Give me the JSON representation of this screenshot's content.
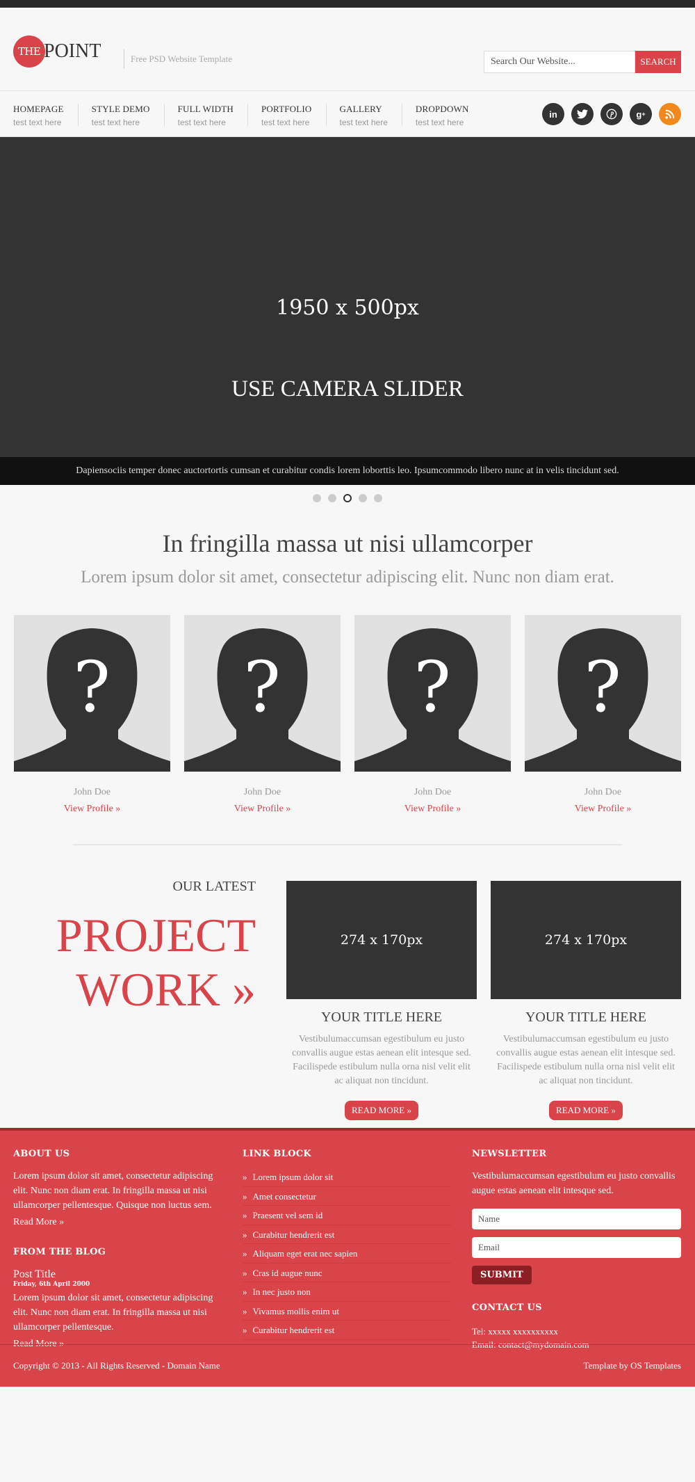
{
  "header": {
    "logo_the": "THE",
    "logo_point": "POINT",
    "tagline": "Free PSD Website Template",
    "search_placeholder": "Search Our Website...",
    "search_button": "SEARCH"
  },
  "nav": {
    "items": [
      {
        "label": "HOMEPAGE",
        "sub": "test text here"
      },
      {
        "label": "STYLE DEMO",
        "sub": "test text here"
      },
      {
        "label": "FULL WIDTH",
        "sub": "test text here"
      },
      {
        "label": "PORTFOLIO",
        "sub": "test text here"
      },
      {
        "label": "GALLERY",
        "sub": "test text here"
      },
      {
        "label": "DROPDOWN",
        "sub": "test text here"
      }
    ],
    "social_icons": [
      "linkedin-icon",
      "twitter-icon",
      "pinterest-icon",
      "google-plus-icon",
      "rss-icon"
    ]
  },
  "hero": {
    "size_label": "1950 x 500px",
    "title": "USE CAMERA SLIDER",
    "caption": "Dapiensociis temper donec auctortortis cumsan et curabitur condis lorem loborttis leo. Ipsumcommodo libero nunc at in velis tincidunt sed.",
    "slides": 5,
    "active_slide": 3
  },
  "intro": {
    "heading": "In fringilla massa ut nisi ullamcorper",
    "subheading": "Lorem ipsum dolor sit amet, consectetur adipiscing elit. Nunc non diam erat."
  },
  "team": [
    {
      "name": "John Doe",
      "link": "View Profile »"
    },
    {
      "name": "John Doe",
      "link": "View Profile »"
    },
    {
      "name": "John Doe",
      "link": "View Profile »"
    },
    {
      "name": "John Doe",
      "link": "View Profile »"
    }
  ],
  "projects": {
    "kicker": "OUR LATEST",
    "title_line1": "PROJECT",
    "title_line2": "WORK »",
    "cards": [
      {
        "image_label": "274 x 170px",
        "title": "YOUR TITLE HERE",
        "text": "Vestibulumaccumsan egestibulum eu justo convallis augue estas aenean elit intesque sed. Facilispede estibulum nulla orna nisl velit elit ac aliquat non tincidunt.",
        "button": "READ MORE »"
      },
      {
        "image_label": "274 x 170px",
        "title": "YOUR TITLE HERE",
        "text": "Vestibulumaccumsan egestibulum eu justo convallis augue estas aenean elit intesque sed. Facilispede estibulum nulla orna nisl velit elit ac aliquat non tincidunt.",
        "button": "READ MORE »"
      }
    ]
  },
  "footer": {
    "about_heading": "ABOUT US",
    "about_text": "Lorem ipsum dolor sit amet, consectetur adipiscing elit. Nunc non diam erat. In fringilla massa ut nisi ullamcorper pellentesque. Quisque non luctus sem.",
    "about_read_more": "Read More »",
    "blog_heading": "FROM THE BLOG",
    "post_title": "Post Title",
    "post_date": "Friday, 6th April 2000",
    "post_text": "Lorem ipsum dolor sit amet, consectetur adipiscing elit. Nunc non diam erat. In fringilla massa ut nisi ullamcorper pellentesque.",
    "post_read_more": "Read More »",
    "links_heading": "LINK BLOCK",
    "links": [
      "Lorem ipsum dolor sit",
      "Amet consectetur",
      "Praesent vel sem id",
      "Curabitur hendrerit est",
      "Aliquam eget erat nec sapien",
      "Cras id augue nunc",
      "In nec justo non",
      "Vivamus mollis enim ut",
      "Curabitur hendrerit est"
    ],
    "newsletter_heading": "NEWSLETTER",
    "newsletter_text": "Vestibulumaccumsan egestibulum eu justo convallis augue estas aenean elit intesque sed.",
    "name_placeholder": "Name",
    "email_placeholder": "Email",
    "submit": "SUBMIT",
    "contact_heading": "CONTACT US",
    "tel": "Tel: xxxxx xxxxxxxxxx",
    "email": "Email: contact@mydomain.com",
    "copyright": "Copyright © 2013 - All Rights Reserved - Domain Name",
    "credit": "Template by OS Templates"
  },
  "colors": {
    "accent": "#d9434a",
    "dark": "#333333",
    "rss": "#f08a1e"
  }
}
